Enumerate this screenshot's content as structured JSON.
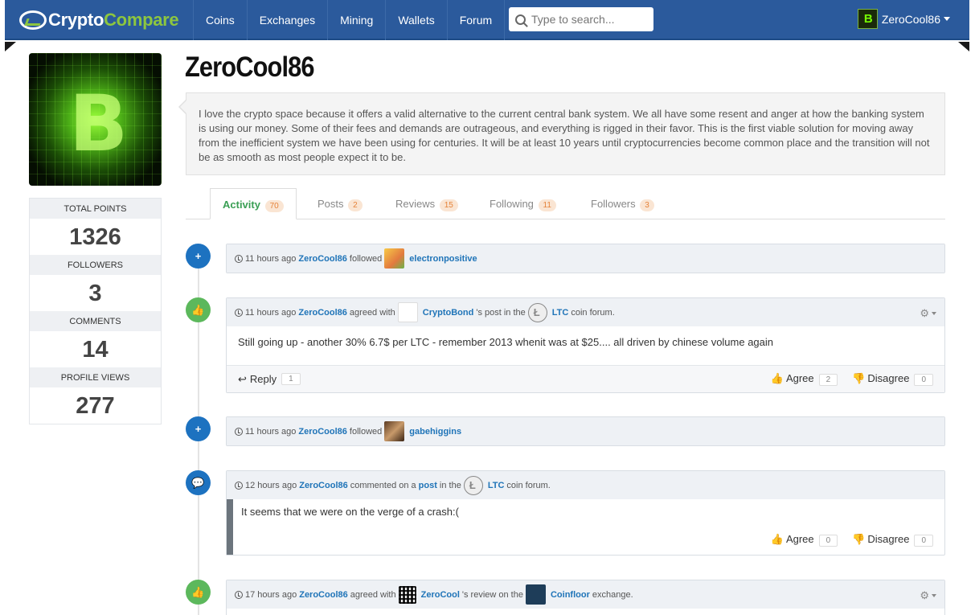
{
  "nav": {
    "logo_a": "Crypto",
    "logo_b": "Compare",
    "items": [
      "Coins",
      "Exchanges",
      "Mining",
      "Wallets",
      "Forum"
    ],
    "search_placeholder": "Type to search...",
    "user": "ZeroCool86"
  },
  "profile": {
    "username": "ZeroCool86",
    "bio": "I love the crypto space because it offers a valid alternative to the current central bank system. We all have some resent and anger at how the banking system is using our money. Some of their fees and demands are outrageous, and everything is rigged in their favor. This is the first viable solution for moving away from the inefficient system we have been using for centuries. It will be at least 10 years until cryptocurrencies become common place and the transition will not be as smooth as most people expect it to be.",
    "stats": [
      {
        "label": "TOTAL POINTS",
        "value": "1326"
      },
      {
        "label": "FOLLOWERS",
        "value": "3"
      },
      {
        "label": "COMMENTS",
        "value": "14"
      },
      {
        "label": "PROFILE VIEWS",
        "value": "277"
      }
    ]
  },
  "tabs": [
    {
      "label": "Activity",
      "count": "70"
    },
    {
      "label": "Posts",
      "count": "2"
    },
    {
      "label": "Reviews",
      "count": "15"
    },
    {
      "label": "Following",
      "count": "11"
    },
    {
      "label": "Followers",
      "count": "3"
    }
  ],
  "feed": {
    "e1": {
      "time": "11 hours ago",
      "user": "ZeroCool86",
      "verb": "followed",
      "target": "electronpositive"
    },
    "e2": {
      "time": "11 hours ago",
      "user": "ZeroCool86",
      "verb": "agreed with",
      "target": "CryptoBond",
      "mid": "'s post in the",
      "coin": "LTC",
      "end": "coin forum.",
      "body": "Still going up - another 30% 6.7$ per LTC - remember 2013 whenit was at $25.... all driven by chinese volume again",
      "reply": "Reply",
      "reply_count": "1",
      "agree": "Agree",
      "agree_count": "2",
      "disagree": "Disagree",
      "disagree_count": "0"
    },
    "e3": {
      "time": "11 hours ago",
      "user": "ZeroCool86",
      "verb": "followed",
      "target": "gabehiggins"
    },
    "e4": {
      "time": "12 hours ago",
      "user": "ZeroCool86",
      "verb": "commented on a",
      "post": "post",
      "mid": "in the",
      "coin": "LTC",
      "end": "coin forum.",
      "body": "It seems that we were on the verge of a crash:(",
      "agree": "Agree",
      "agree_count": "0",
      "disagree": "Disagree",
      "disagree_count": "0"
    },
    "e5": {
      "time": "17 hours ago",
      "user": "ZeroCool86",
      "verb": "agreed with",
      "target": "ZeroCool",
      "mid": "'s review on the",
      "exchange": "Coinfloor",
      "end": "exchange."
    }
  },
  "colors": {
    "nav": "#2b5a9c",
    "accent_green": "#8dc63f",
    "link": "#1f74b8",
    "active_tab": "#3a9f54"
  }
}
